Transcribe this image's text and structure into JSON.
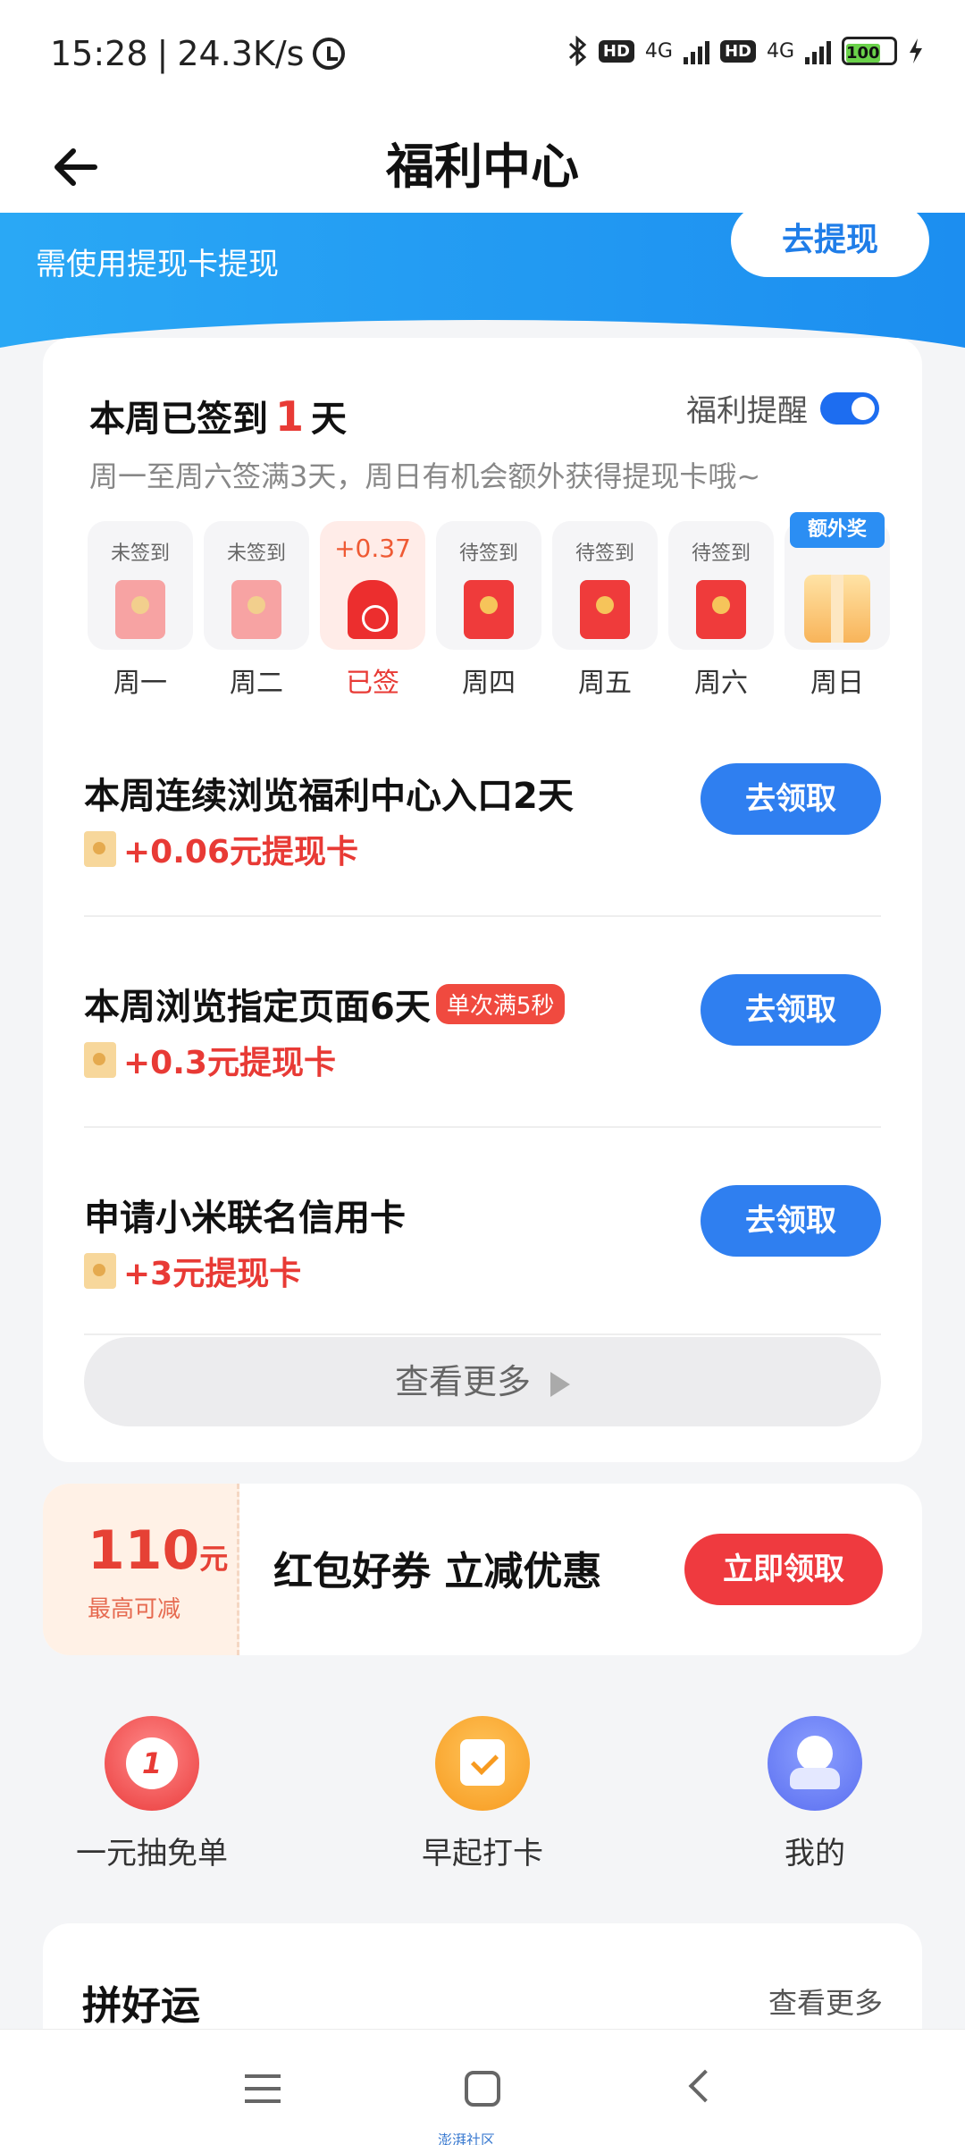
{
  "status_bar": {
    "time": "15:28",
    "speed": "24.3K/s",
    "network1": "4G",
    "network2": "4G",
    "hd_label": "HD",
    "battery": "100"
  },
  "header": {
    "title": "福利中心"
  },
  "banner": {
    "note": "需使用提现卡提现",
    "withdraw_label": "去提现"
  },
  "signin": {
    "title_prefix": "本周已签到",
    "count": "1",
    "title_suffix": "天",
    "reminder_label": "福利提醒",
    "reminder_on": true,
    "subtitle": "周一至周六签满3天，周日有机会额外获得提现卡哦~",
    "days": [
      {
        "tag": "未签到",
        "label": "周一",
        "state": "missed"
      },
      {
        "tag": "未签到",
        "label": "周二",
        "state": "missed"
      },
      {
        "tag": "+0.37",
        "label": "已签",
        "state": "signed"
      },
      {
        "tag": "待签到",
        "label": "周四",
        "state": "pending"
      },
      {
        "tag": "待签到",
        "label": "周五",
        "state": "pending"
      },
      {
        "tag": "待签到",
        "label": "周六",
        "state": "pending"
      },
      {
        "tag": "额外奖",
        "label": "周日",
        "state": "bonus"
      }
    ]
  },
  "tasks": [
    {
      "title": "本周连续浏览福利中心入口2天",
      "tag": "",
      "reward": "+0.06元提现卡",
      "button": "去领取"
    },
    {
      "title": "本周浏览指定页面6天",
      "tag": "单次满5秒",
      "reward": "+0.3元提现卡",
      "button": "去领取"
    },
    {
      "title": "申请小米联名信用卡",
      "tag": "",
      "reward": "+3元提现卡",
      "button": "去领取"
    }
  ],
  "more_label": "查看更多",
  "coupon": {
    "amount": "110",
    "unit": "元",
    "note": "最高可减",
    "title": "红包好券 立减优惠",
    "button": "立即领取"
  },
  "shortcuts": [
    {
      "label": "一元抽免单",
      "icon": "lottery-icon",
      "glyph": "1"
    },
    {
      "label": "早起打卡",
      "icon": "calendar-check-icon"
    },
    {
      "label": "我的",
      "icon": "user-icon"
    }
  ],
  "luck": {
    "title": "拼好运",
    "more": "查看更多"
  },
  "navbar": {
    "caption": "澎湃社区"
  }
}
